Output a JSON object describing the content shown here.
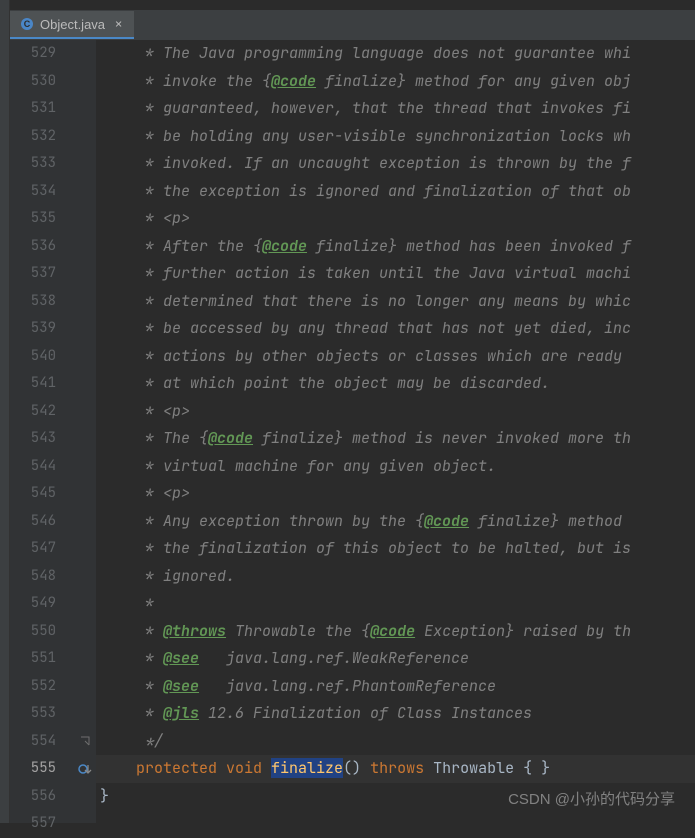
{
  "tab": {
    "filename": "Object.java"
  },
  "watermark": "CSDN @小孙的代码分享",
  "gutter": {
    "start": 529,
    "end": 557,
    "current": 555
  },
  "lines": {
    "529": [
      {
        "cls": "c-comment",
        "text": "     * The Java programming language does not guarantee whi"
      }
    ],
    "530": [
      {
        "cls": "c-comment",
        "text": "     * invoke the {"
      },
      {
        "cls": "c-tag",
        "text": "@code"
      },
      {
        "cls": "c-comment",
        "text": " finalize} method for any given obj"
      }
    ],
    "531": [
      {
        "cls": "c-comment",
        "text": "     * guaranteed, however, that the thread that invokes fi"
      }
    ],
    "532": [
      {
        "cls": "c-comment",
        "text": "     * be holding any user-visible synchronization locks wh"
      }
    ],
    "533": [
      {
        "cls": "c-comment",
        "text": "     * invoked. If an uncaught exception is thrown by the f"
      }
    ],
    "534": [
      {
        "cls": "c-comment",
        "text": "     * the exception is ignored and finalization of that ob"
      }
    ],
    "535": [
      {
        "cls": "c-comment",
        "text": "     * "
      },
      {
        "cls": "c-html",
        "text": "<p>"
      }
    ],
    "536": [
      {
        "cls": "c-comment",
        "text": "     * After the {"
      },
      {
        "cls": "c-tag",
        "text": "@code"
      },
      {
        "cls": "c-comment",
        "text": " finalize} method has been invoked f"
      }
    ],
    "537": [
      {
        "cls": "c-comment",
        "text": "     * further action is taken until the Java virtual machi"
      }
    ],
    "538": [
      {
        "cls": "c-comment",
        "text": "     * determined that there is no longer any means by whic"
      }
    ],
    "539": [
      {
        "cls": "c-comment",
        "text": "     * be accessed by any thread that has not yet died, inc"
      }
    ],
    "540": [
      {
        "cls": "c-comment",
        "text": "     * actions by other objects or classes which are ready "
      }
    ],
    "541": [
      {
        "cls": "c-comment",
        "text": "     * at which point the object may be discarded."
      }
    ],
    "542": [
      {
        "cls": "c-comment",
        "text": "     * "
      },
      {
        "cls": "c-html",
        "text": "<p>"
      }
    ],
    "543": [
      {
        "cls": "c-comment",
        "text": "     * The {"
      },
      {
        "cls": "c-tag",
        "text": "@code"
      },
      {
        "cls": "c-comment",
        "text": " finalize} method is never invoked more th"
      }
    ],
    "544": [
      {
        "cls": "c-comment",
        "text": "     * virtual machine for any given object."
      }
    ],
    "545": [
      {
        "cls": "c-comment",
        "text": "     * "
      },
      {
        "cls": "c-html",
        "text": "<p>"
      }
    ],
    "546": [
      {
        "cls": "c-comment",
        "text": "     * Any exception thrown by the {"
      },
      {
        "cls": "c-tag",
        "text": "@code"
      },
      {
        "cls": "c-comment",
        "text": " finalize} method "
      }
    ],
    "547": [
      {
        "cls": "c-comment",
        "text": "     * the finalization of this object to be halted, but is"
      }
    ],
    "548": [
      {
        "cls": "c-comment",
        "text": "     * ignored."
      }
    ],
    "549": [
      {
        "cls": "c-comment",
        "text": "     *"
      }
    ],
    "550": [
      {
        "cls": "c-comment",
        "text": "     * "
      },
      {
        "cls": "c-tag",
        "text": "@throws"
      },
      {
        "cls": "c-comment",
        "text": " Throwable "
      },
      {
        "cls": "c-comment",
        "text": "the {"
      },
      {
        "cls": "c-tag",
        "text": "@code"
      },
      {
        "cls": "c-comment",
        "text": " Exception} raised by th"
      }
    ],
    "551": [
      {
        "cls": "c-comment",
        "text": "     * "
      },
      {
        "cls": "c-tag",
        "text": "@see"
      },
      {
        "cls": "c-comment",
        "text": "   java.lang.ref.WeakReference"
      }
    ],
    "552": [
      {
        "cls": "c-comment",
        "text": "     * "
      },
      {
        "cls": "c-tag",
        "text": "@see"
      },
      {
        "cls": "c-comment",
        "text": "   java.lang.ref.PhantomReference"
      }
    ],
    "553": [
      {
        "cls": "c-comment",
        "text": "     * "
      },
      {
        "cls": "c-tag",
        "text": "@jls"
      },
      {
        "cls": "c-comment",
        "text": " 12.6 Finalization of Class Instances"
      }
    ],
    "554": [
      {
        "cls": "c-comment",
        "text": "     */"
      }
    ],
    "555": [
      {
        "cls": "c-ident",
        "text": "    "
      },
      {
        "cls": "c-kw",
        "text": "protected void "
      },
      {
        "cls": "c-method-hl",
        "text": "finalize"
      },
      {
        "cls": "c-ident",
        "text": "() "
      },
      {
        "cls": "c-kw",
        "text": "throws "
      },
      {
        "cls": "c-throws-t",
        "text": "Throwable { }"
      }
    ],
    "556": [
      {
        "cls": "c-ident",
        "text": "}"
      }
    ],
    "557": [
      {
        "cls": "c-ident",
        "text": ""
      }
    ]
  }
}
